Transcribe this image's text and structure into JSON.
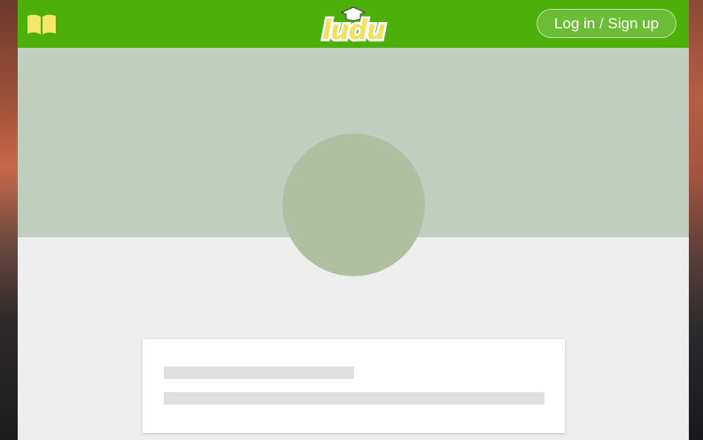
{
  "header": {
    "logo_text": "ludu",
    "login_label": "Log in / Sign up",
    "menu_icon": "book-icon"
  },
  "colors": {
    "navbar": "#4caf0a",
    "cover": "#c0cec0",
    "avatar_placeholder": "#afbf9f",
    "page_background": "#eeeeee",
    "skeleton": "#e0e0e0"
  }
}
